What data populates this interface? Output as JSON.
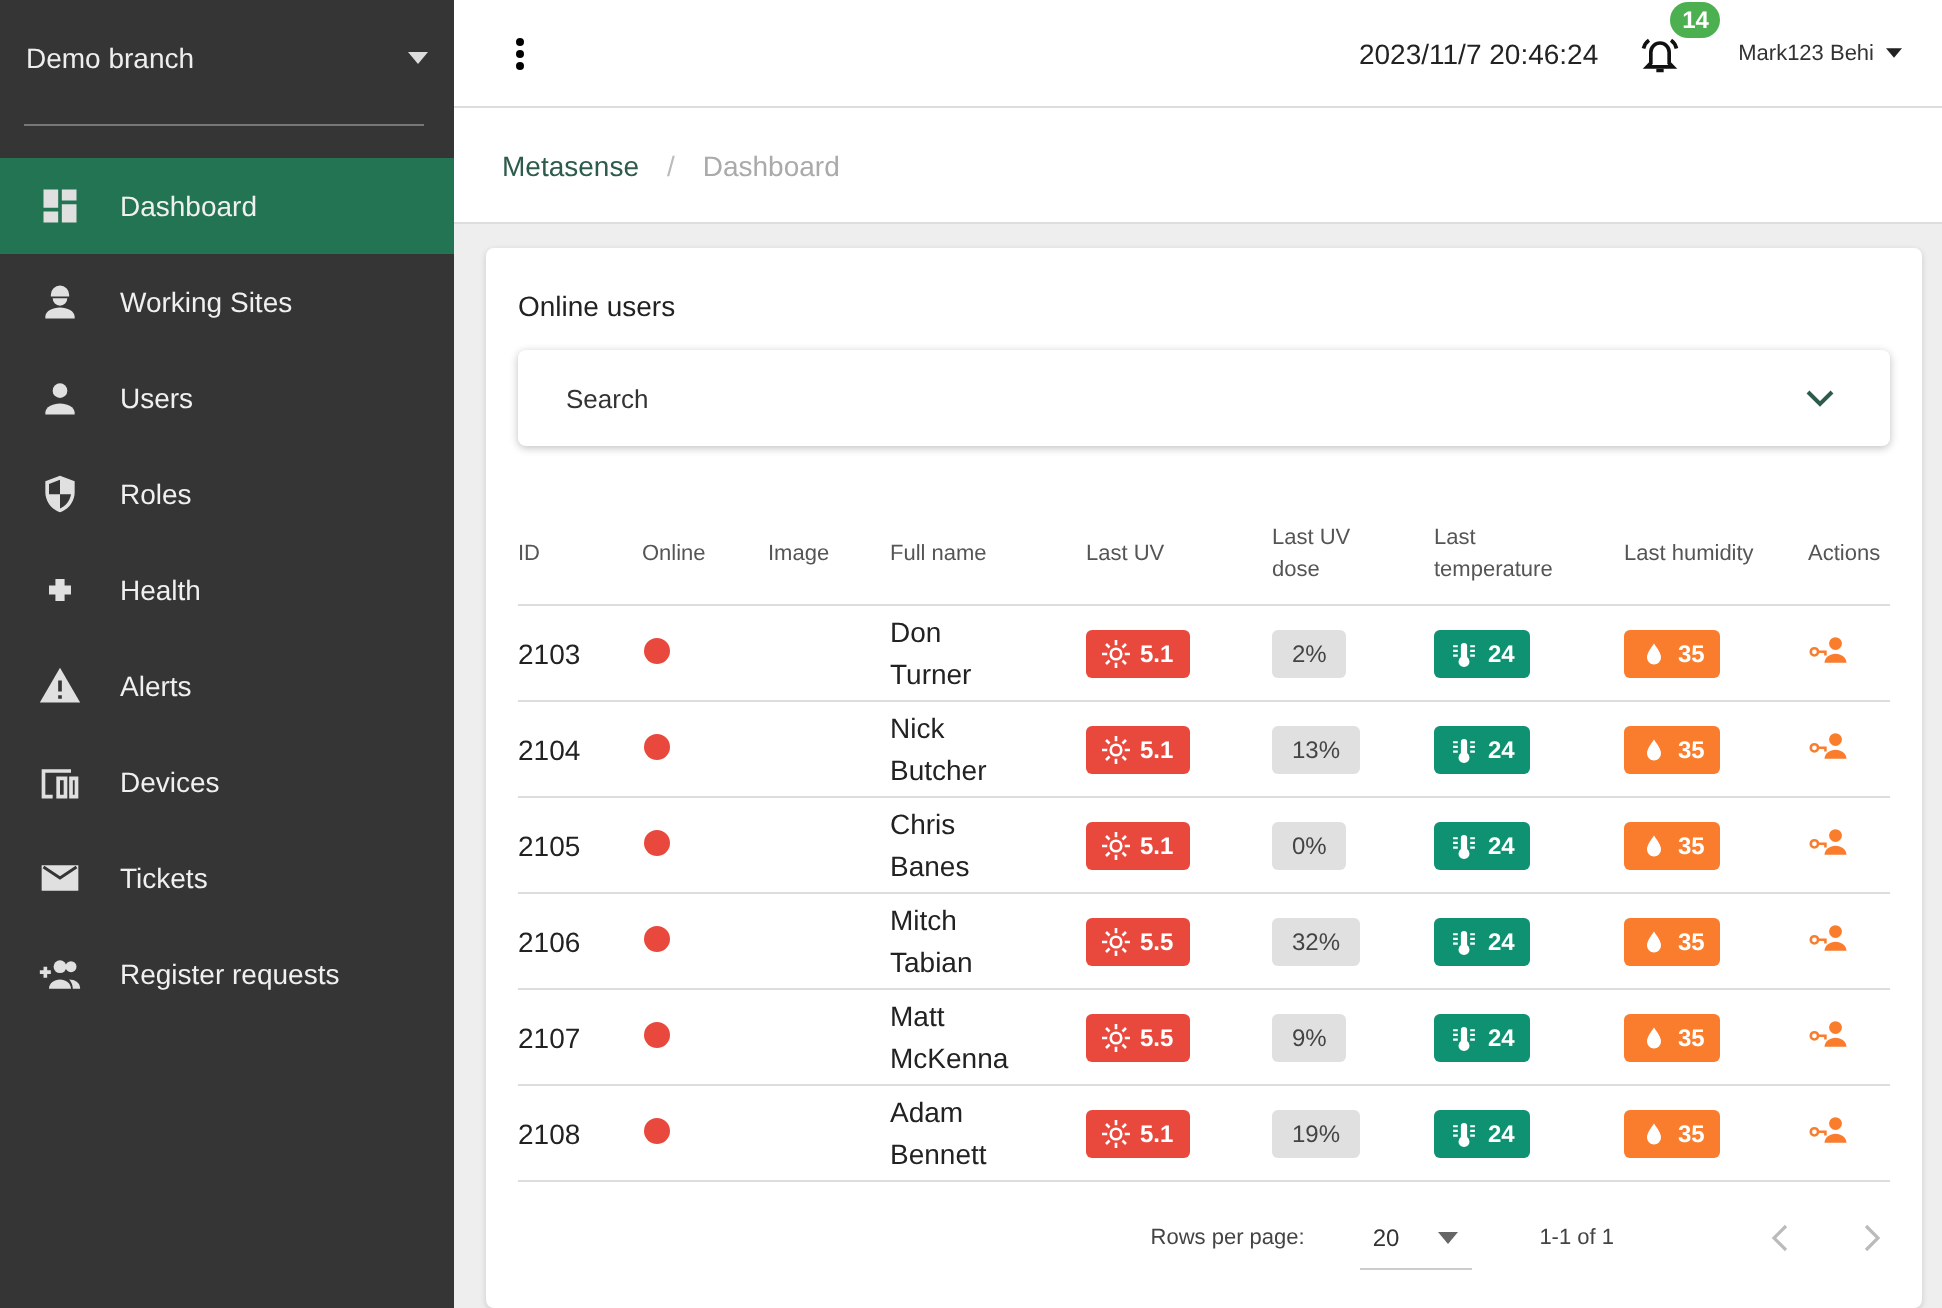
{
  "sidebar": {
    "branch": "Demo branch",
    "items": [
      {
        "label": "Dashboard",
        "selected": true
      },
      {
        "label": "Working Sites",
        "selected": false
      },
      {
        "label": "Users",
        "selected": false
      },
      {
        "label": "Roles",
        "selected": false
      },
      {
        "label": "Health",
        "selected": false
      },
      {
        "label": "Alerts",
        "selected": false
      },
      {
        "label": "Devices",
        "selected": false
      },
      {
        "label": "Tickets",
        "selected": false
      },
      {
        "label": "Register requests",
        "selected": false
      }
    ]
  },
  "header": {
    "datetime": "2023/11/7 20:46:24",
    "notifications": "14",
    "user": "Mark123 Behi"
  },
  "breadcrumb": {
    "items": [
      "Metasense",
      "Dashboard"
    ],
    "separator": "/"
  },
  "card": {
    "title": "Online users",
    "search": {
      "label": "Search",
      "expanded": false
    }
  },
  "table": {
    "columns": [
      "ID",
      "Online",
      "Image",
      "Full name",
      "Last UV",
      "Last UV dose",
      "Last temperature",
      "Last humidity",
      "Actions"
    ],
    "rows": [
      {
        "id": "2103",
        "online": false,
        "name": "Don Turner",
        "uv": "5.1",
        "dose": "2%",
        "temp": "24",
        "humidity": "35"
      },
      {
        "id": "2104",
        "online": false,
        "name": "Nick Butcher",
        "uv": "5.1",
        "dose": "13%",
        "temp": "24",
        "humidity": "35"
      },
      {
        "id": "2105",
        "online": false,
        "name": "Chris Banes",
        "uv": "5.1",
        "dose": "0%",
        "temp": "24",
        "humidity": "35"
      },
      {
        "id": "2106",
        "online": false,
        "name": "Mitch Tabian",
        "uv": "5.5",
        "dose": "32%",
        "temp": "24",
        "humidity": "35"
      },
      {
        "id": "2107",
        "online": false,
        "name": "Matt McKenna",
        "uv": "5.5",
        "dose": "9%",
        "temp": "24",
        "humidity": "35"
      },
      {
        "id": "2108",
        "online": false,
        "name": "Adam Bennett",
        "uv": "5.1",
        "dose": "19%",
        "temp": "24",
        "humidity": "35"
      }
    ]
  },
  "pagination": {
    "rows_label": "Rows per page:",
    "rows_value": "20",
    "range": "1-1 of 1",
    "prev_disabled": true,
    "next_disabled": true
  }
}
